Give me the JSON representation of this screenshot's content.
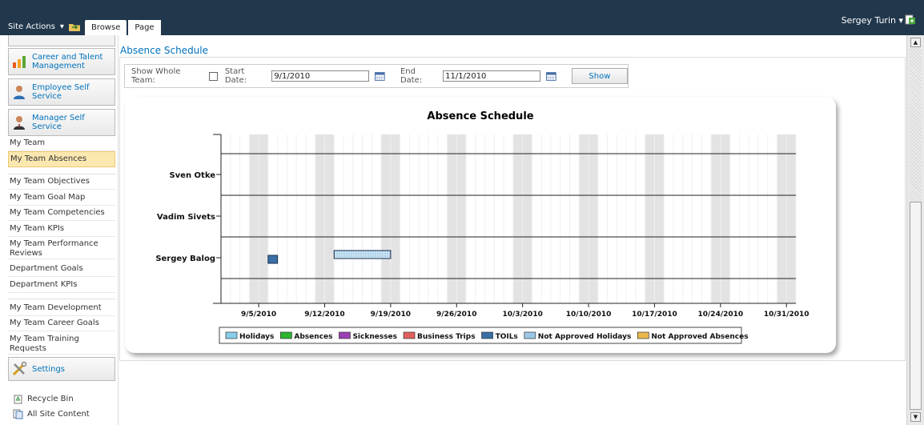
{
  "ribbon": {
    "site_actions": "Site Actions",
    "site_actions_arrow": "▾",
    "tab_browse": "Browse",
    "tab_page": "Page",
    "user_name": "Sergey Turin",
    "user_arrow": "▾"
  },
  "nav": {
    "buttons": [
      {
        "label": "Career and Talent Management",
        "icon": "chart-icon"
      },
      {
        "label": "Employee Self Service",
        "icon": "person-icon"
      },
      {
        "label": "Manager Self Service",
        "icon": "manager-icon"
      }
    ],
    "items": [
      "My Team",
      "My Team Absences",
      "My Team Objectives",
      "My Team Goal Map",
      "My Team Competencies",
      "My Team KPIs",
      "My Team Performance Reviews",
      "Department Goals",
      "Department KPIs",
      "My Team Development",
      "My Team Career Goals",
      "My Team Training Requests"
    ],
    "settings": "Settings",
    "recycle_bin": "Recycle Bin",
    "all_site_content": "All Site Content"
  },
  "main": {
    "page_title": "Absence Schedule",
    "filter": {
      "show_whole_team": "Show Whole Team:",
      "start_label": "Start Date:",
      "start_value": "9/1/2010",
      "end_label": "End Date:",
      "end_value": "11/1/2010",
      "show_button": "Show"
    }
  },
  "chart_data": {
    "type": "gantt",
    "title": "Absence Schedule",
    "x_start": "9/1/2010",
    "x_end": "11/1/2010",
    "x_ticks": [
      "9/5/2010",
      "9/12/2010",
      "9/19/2010",
      "9/26/2010",
      "10/3/2010",
      "10/10/2010",
      "10/17/2010",
      "10/24/2010",
      "10/31/2010"
    ],
    "rows": [
      "Sven Otke",
      "Vadim Sivets",
      "Sergey Balog"
    ],
    "bars": [
      {
        "row": "Sergey Balog",
        "start": "9/6/2010",
        "end": "9/7/2010",
        "type": "TOILs"
      },
      {
        "row": "Sergey Balog",
        "start": "9/13/2010",
        "end": "9/19/2010",
        "type": "Not Approved Holidays"
      }
    ],
    "legend": [
      {
        "name": "Holidays",
        "color": "#87ceeb"
      },
      {
        "name": "Absences",
        "color": "#2db52d"
      },
      {
        "name": "Sicknesses",
        "color": "#9b3fb5"
      },
      {
        "name": "Business Trips",
        "color": "#e06060"
      },
      {
        "name": "TOILs",
        "color": "#3a6ea5"
      },
      {
        "name": "Not Approved Holidays",
        "color": "#9cc7e6"
      },
      {
        "name": "Not Approved Absences",
        "color": "#e8b84a"
      }
    ]
  }
}
